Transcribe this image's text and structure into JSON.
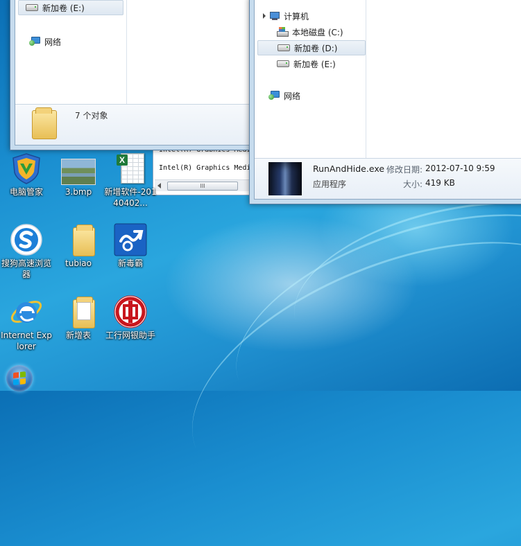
{
  "window_left": {
    "nav": {
      "drive_e": "新加卷 (E:)",
      "network": "网络"
    },
    "status": {
      "count": "7 个对象"
    }
  },
  "window_right": {
    "nav": {
      "computer": "计算机",
      "drive_c": "本地磁盘 (C:)",
      "drive_d": "新加卷 (D:)",
      "drive_e": "新加卷 (E:)",
      "network": "网络"
    },
    "details": {
      "filename": "RunAndHide.exe",
      "modified_label": "修改日期:",
      "modified_value": "2012-07-10 9:59",
      "type": "应用程序",
      "size_label": "大小:",
      "size_value": "419 KB"
    }
  },
  "background_window": {
    "text_top": "Intel(R) Graphics Media",
    "text_line": "Intel(R) Graphics Medi",
    "scroll_thumb": "III"
  },
  "desktop": {
    "icons": [
      {
        "label": "电脑管家",
        "icon": "shield-icon"
      },
      {
        "label": "3.bmp",
        "icon": "image-thumbnail-icon"
      },
      {
        "label": "新增软件-20140402...",
        "icon": "excel-file-icon"
      },
      {
        "label": "搜狗高速浏览器",
        "icon": "sogou-browser-icon"
      },
      {
        "label": "tubiao",
        "icon": "folder-icon"
      },
      {
        "label": "新毒霸",
        "icon": "antivirus-icon"
      },
      {
        "label": "Internet Explorer",
        "icon": "ie-icon"
      },
      {
        "label": "新增表",
        "icon": "folder-icon"
      },
      {
        "label": "工行网银助手",
        "icon": "icbc-icon"
      }
    ]
  },
  "colors": {
    "accent": "#1a8ed0",
    "selection": "#dde7f1"
  }
}
